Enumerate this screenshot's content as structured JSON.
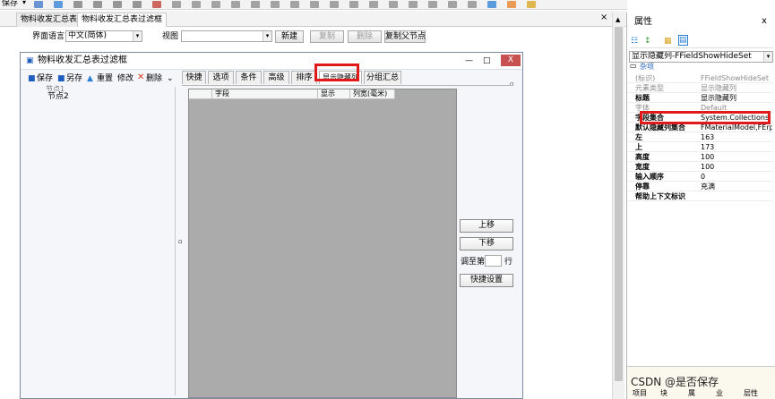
{
  "toolbar": {
    "save_label": "保存",
    "icons": [
      "new-icon",
      "save-icon",
      "cut-icon",
      "copy-icon",
      "undo-icon",
      "redo-icon",
      "delete-icon",
      "align-icon",
      "align-icon",
      "align-icon",
      "align-icon",
      "align-icon",
      "align-icon",
      "align-icon",
      "align-icon",
      "align-icon",
      "align-icon",
      "align-icon",
      "layout-icon",
      "layout-icon",
      "layout-icon",
      "layout-icon",
      "layout-icon",
      "link-icon",
      "link-icon",
      "lock-icon"
    ]
  },
  "doc_tabs": [
    {
      "label": "物料收发汇总表",
      "active": false
    },
    {
      "label": "物料收发汇总表过滤框",
      "active": true
    }
  ],
  "controls": {
    "language_label": "界面语言",
    "language_value": "中文(简体)",
    "view_label": "视图",
    "view_value": "",
    "new_btn": "新建",
    "copy_btn": "复制",
    "delete_btn": "删除",
    "copy_parent_btn": "复制父节点"
  },
  "dialog": {
    "title": "物料收发汇总表过滤框",
    "close": "X",
    "tree_toolbar": {
      "save": "保存",
      "save_as": "另存",
      "reset": "重置",
      "modify": "修改",
      "delete": "删除"
    },
    "tree_nodes": [
      "节点1",
      "节点2"
    ],
    "tabs": [
      "快捷",
      "选项",
      "条件",
      "高级",
      "排序",
      "显示隐藏列",
      "分组汇总"
    ],
    "active_tab": "显示隐藏列",
    "grid_columns": [
      "",
      "字段",
      "显示",
      "列宽(毫米)"
    ],
    "move_up": "上移",
    "move_down": "下移",
    "adjust_to_prefix": "调至第",
    "adjust_to_suffix": "行",
    "adjust_to_value": "",
    "quick_settings": "快捷设置"
  },
  "properties": {
    "title": "属性",
    "close": "x",
    "selected_object": "显示隐藏列-FFieldShowHideSet",
    "category": "杂项",
    "rows": [
      {
        "key": "(标识)",
        "value": "FFieldShowHideSet",
        "style": "muted"
      },
      {
        "key": "元素类型",
        "value": "显示隐藏列",
        "style": "muted"
      },
      {
        "key": "标题",
        "value": "显示隐藏列",
        "style": "bold"
      },
      {
        "key": "字体",
        "value": "Default",
        "style": "muted"
      },
      {
        "key": "字段集合",
        "value": "System.Collections.",
        "style": "bold"
      },
      {
        "key": "默认隐藏列集合",
        "value": "FMaterialModel,FErp",
        "style": "bold"
      },
      {
        "key": "左",
        "value": "163",
        "style": "bold"
      },
      {
        "key": "上",
        "value": "173",
        "style": "bold"
      },
      {
        "key": "高度",
        "value": "100",
        "style": "bold"
      },
      {
        "key": "宽度",
        "value": "100",
        "style": "bold"
      },
      {
        "key": "输入顺序",
        "value": "0",
        "style": "bold"
      },
      {
        "key": "停靠",
        "value": "充满",
        "style": "bold"
      },
      {
        "key": "帮助上下文标识",
        "value": "",
        "style": "bold"
      }
    ],
    "bottom_tabs": [
      "项目",
      "块",
      "属",
      "业",
      "层性"
    ]
  },
  "watermark": "CSDN @是否保存",
  "colors": {
    "highlight": "#e01a1a",
    "accent_blue": "#1f5fbf",
    "grid_bg": "#ababab"
  }
}
